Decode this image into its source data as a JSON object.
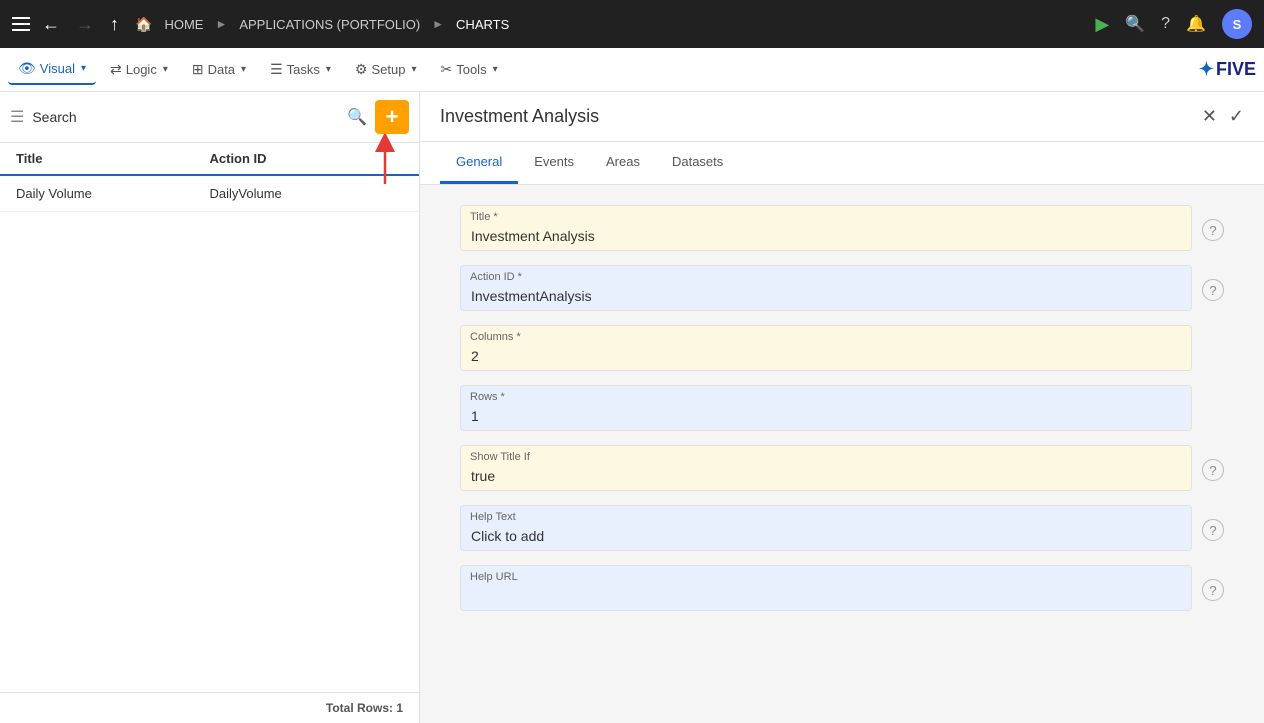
{
  "topNav": {
    "home": "HOME",
    "applications": "APPLICATIONS (PORTFOLIO)",
    "charts": "CHARTS",
    "userInitial": "S"
  },
  "secondNav": {
    "items": [
      {
        "label": "Visual",
        "icon": "👁",
        "active": true
      },
      {
        "label": "Logic",
        "icon": "⇄",
        "active": false
      },
      {
        "label": "Data",
        "icon": "⊞",
        "active": false
      },
      {
        "label": "Tasks",
        "icon": "☰",
        "active": false
      },
      {
        "label": "Setup",
        "icon": "⚙",
        "active": false
      },
      {
        "label": "Tools",
        "icon": "✂",
        "active": false
      }
    ]
  },
  "leftPanel": {
    "searchPlaceholder": "Search",
    "searchValue": "Search",
    "columns": [
      {
        "label": "Title"
      },
      {
        "label": "Action ID"
      }
    ],
    "rows": [
      {
        "title": "Daily Volume",
        "actionId": "DailyVolume"
      }
    ],
    "footer": "Total Rows: 1"
  },
  "rightPanel": {
    "title": "Investment Analysis",
    "tabs": [
      {
        "label": "General",
        "active": true
      },
      {
        "label": "Events",
        "active": false
      },
      {
        "label": "Areas",
        "active": false
      },
      {
        "label": "Datasets",
        "active": false
      }
    ],
    "form": {
      "fields": [
        {
          "label": "Title *",
          "value": "Investment Analysis",
          "bg": "yellow",
          "hasHelp": true
        },
        {
          "label": "Action ID *",
          "value": "InvestmentAnalysis",
          "bg": "blue",
          "hasHelp": true
        },
        {
          "label": "Columns *",
          "value": "2",
          "bg": "yellow",
          "hasHelp": false
        },
        {
          "label": "Rows *",
          "value": "1",
          "bg": "blue",
          "hasHelp": false
        },
        {
          "label": "Show Title If",
          "value": "true",
          "bg": "yellow",
          "hasHelp": true
        },
        {
          "label": "Help Text",
          "value": "Click to add",
          "bg": "blue",
          "hasHelp": true
        },
        {
          "label": "Help URL",
          "value": "",
          "bg": "blue",
          "hasHelp": true
        }
      ]
    }
  }
}
